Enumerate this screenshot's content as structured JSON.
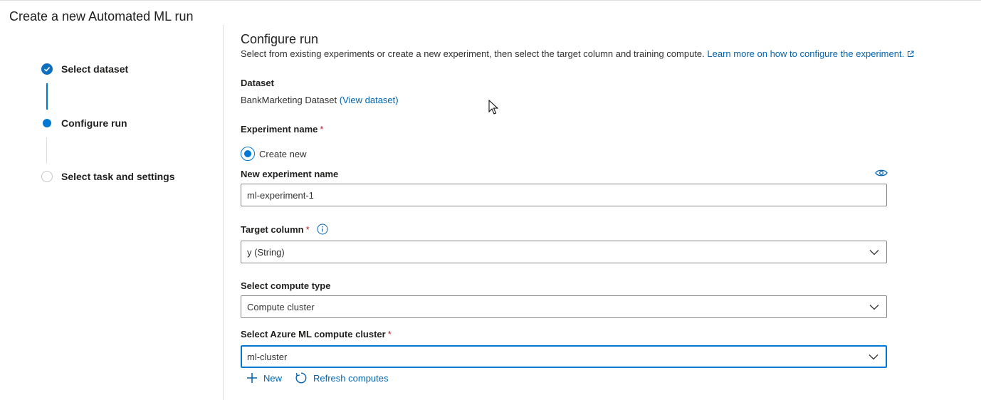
{
  "page": {
    "title": "Create a new Automated ML run"
  },
  "stepper": {
    "steps": [
      {
        "label": "Select dataset",
        "state": "completed"
      },
      {
        "label": "Configure run",
        "state": "current"
      },
      {
        "label": "Select task and settings",
        "state": "pending"
      }
    ]
  },
  "main": {
    "title": "Configure run",
    "description": "Select from existing experiments or create a new experiment, then select the target column and training compute.",
    "learn_more": "Learn more on how to configure the experiment.",
    "dataset": {
      "label": "Dataset",
      "name": "BankMarketing Dataset",
      "view_link": "(View dataset)"
    },
    "experiment": {
      "label": "Experiment name",
      "required_mark": "*",
      "radio_label": "Create new",
      "new_name_label": "New experiment name",
      "new_name_value": "ml-experiment-1"
    },
    "target_column": {
      "label": "Target column",
      "required_mark": "*",
      "value": "y (String)"
    },
    "compute_type": {
      "label": "Select compute type",
      "value": "Compute cluster"
    },
    "compute_cluster": {
      "label": "Select Azure ML compute cluster",
      "required_mark": "*",
      "value": "ml-cluster"
    },
    "actions": {
      "new_label": "New",
      "refresh_label": "Refresh computes"
    }
  },
  "colors": {
    "accent": "#0078d4",
    "link": "#0063b1",
    "required": "#a4262c",
    "border": "#8a8886"
  },
  "icons": [
    "checkmark-icon",
    "external-link-icon",
    "eye-icon",
    "info-icon",
    "chevron-down-icon",
    "plus-icon",
    "refresh-icon",
    "mouse-cursor-icon"
  ]
}
